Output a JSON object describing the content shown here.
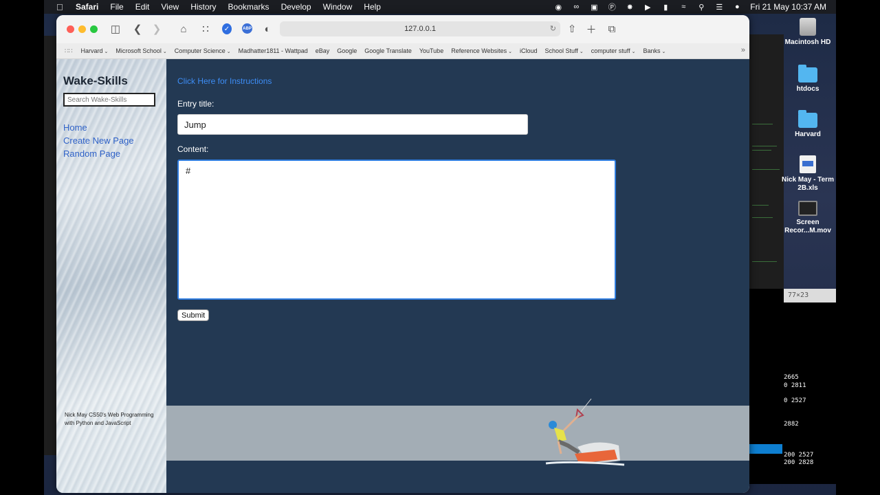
{
  "menubar": {
    "app": "Safari",
    "items": [
      "File",
      "Edit",
      "View",
      "History",
      "Bookmarks",
      "Develop",
      "Window",
      "Help"
    ],
    "datetime": "Fri 21 May  10:37 AM"
  },
  "browser": {
    "address": "127.0.0.1",
    "bookmarks": [
      {
        "label": "Harvard",
        "menu": true
      },
      {
        "label": "Microsoft School",
        "menu": true
      },
      {
        "label": "Computer Science",
        "menu": true
      },
      {
        "label": "Madhatter1811 - Wattpad",
        "menu": false
      },
      {
        "label": "eBay",
        "menu": false
      },
      {
        "label": "Google",
        "menu": false
      },
      {
        "label": "Google Translate",
        "menu": false
      },
      {
        "label": "YouTube",
        "menu": false
      },
      {
        "label": "Reference Websites",
        "menu": true
      },
      {
        "label": "iCloud",
        "menu": false
      },
      {
        "label": "School Stuff",
        "menu": true
      },
      {
        "label": "computer stuff",
        "menu": true
      },
      {
        "label": "Banks",
        "menu": true
      }
    ]
  },
  "sidebar": {
    "title": "Wake-Skills",
    "search_placeholder": "Search Wake-Skills",
    "nav": [
      "Home",
      "Create New Page",
      "Random Page"
    ],
    "footer": "Nick May CS50's Web Programming with Python and JavaScript"
  },
  "main": {
    "instructions_link": "Click Here for Instructions",
    "entry_title_label": "Entry title:",
    "entry_title_value": "Jump",
    "content_label": "Content:",
    "content_value": "# ",
    "submit_label": "Submit"
  },
  "desktop": {
    "icons": [
      "Macintosh HD",
      "htdocs",
      "Harvard",
      "Nick May - Term 2B.xls",
      "Screen Recor...M.mov"
    ]
  },
  "terminal": {
    "size": "77×23",
    "lines": [
      "2665",
      "0 2811",
      "0 2527",
      "2882",
      "200 2527",
      "200 2828"
    ]
  },
  "colors": {
    "page_bg": "#233953",
    "link": "#3d8df5",
    "nav_link": "#2f62c8",
    "footer_band": "#a3adb5"
  }
}
